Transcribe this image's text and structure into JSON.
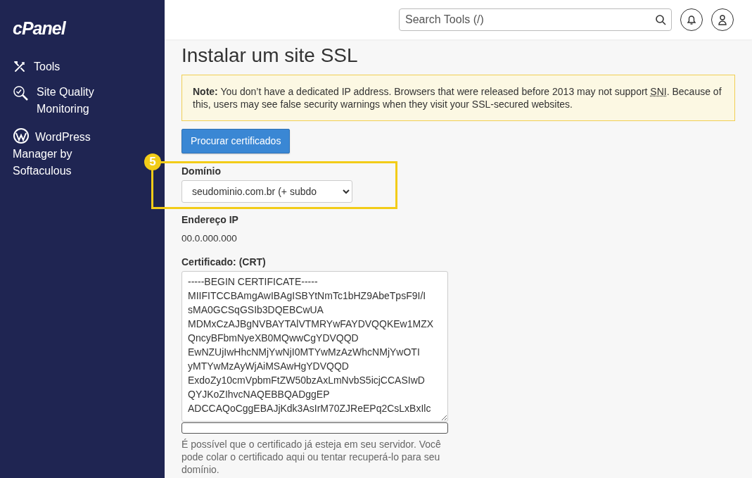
{
  "sidebar": {
    "logo": "cPanel",
    "items": [
      {
        "kind": "tools",
        "label": "Tools"
      },
      {
        "kind": "quality",
        "label": "Site Quality Monitoring"
      },
      {
        "kind": "wordpress",
        "label": "WordPress Manager by Softaculous"
      }
    ]
  },
  "header": {
    "search": {
      "placeholder": "Search Tools (/)"
    }
  },
  "page": {
    "title": "Instalar um site SSL",
    "note": {
      "before": "**Note:** You don’t have a dedicated IP address. Browsers that were released before 2013 may not support ",
      "abbr": "SNI",
      "after": ". Because of this, users may see false security warnings when they visit your SSL-secured websites."
    },
    "browse_button": "Procurar certificados",
    "callout": {
      "number": "5"
    },
    "domain": {
      "label": "Domínio",
      "value": "seudominio.com.br    (+ subdo"
    },
    "ip": {
      "label": "Endereço IP",
      "value": "00.0.000.000"
    },
    "certificate": {
      "label": "Certificado: (CRT)",
      "lines": [
        "-----BEGIN CERTIFICATE-----",
        "MIIFITCCBAmgAwIBAgISBYtNmTc1bHZ9AbeTpsF9I/I",
        "sMA0GCSqGSIb3DQEBCwUA",
        "MDMxCzAJBgNVBAYTAlVTMRYwFAYDVQQKEw1MZX",
        "QncyBFbmNyeXB0MQwwCgYDVQQD",
        "EwNZUjIwHhcNMjYwNjI0MTYwMzAzWhcNMjYwOTI",
        "yMTYwMzAyWjAiMSAwHgYDVQQD",
        "ExdoZy10cmVpbmFtZW50bzAxLmNvbS5icjCCASIwD",
        "QYJKoZIhvcNAQEBBQADggEP",
        "ADCCAQoCggEBAJjKdk3AsIrM70ZJReEPq2CsLxBxIlc"
      ],
      "help": "É possível que o certificado já esteja em seu servidor. Você pode colar o certificado aqui ou tentar recuperá-lo para seu domínio."
    }
  }
}
